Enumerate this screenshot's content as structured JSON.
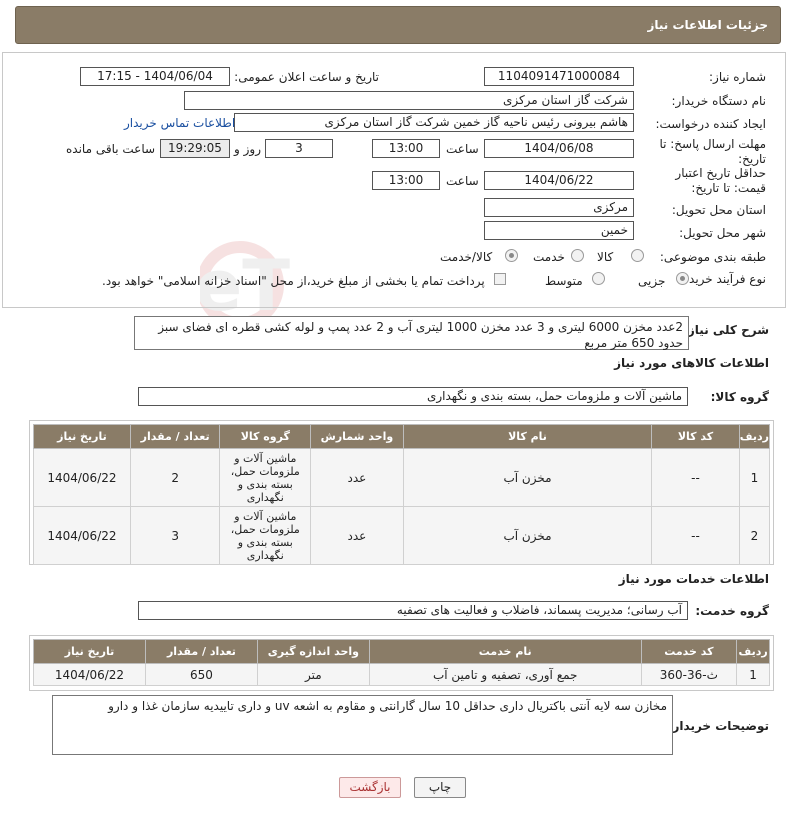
{
  "header": {
    "title": "جزئیات اطلاعات نیاز"
  },
  "form": {
    "need_number_label": "شماره نیاز:",
    "need_number": "1104091471000084",
    "announce_label": "تاریخ و ساعت اعلان عمومی:",
    "announce_value": "1404/06/04 - 17:15",
    "buyer_org_label": "نام دستگاه خریدار:",
    "buyer_org": "شرکت گاز استان مرکزی",
    "creator_label": "ایجاد کننده درخواست:",
    "creator": "هاشم بیرونی رئیس ناحیه گاز خمین شرکت گاز استان مرکزی",
    "contact_link": "اطلاعات تماس خریدار",
    "deadline_label": "مهلت ارسال پاسخ: تا تاریخ:",
    "deadline_date": "1404/06/08",
    "time_label": "ساعت",
    "deadline_time": "13:00",
    "days_value": "3",
    "days_label": "روز و",
    "remaining_time": "19:29:05",
    "remaining_label": "ساعت باقی مانده",
    "price_validity_label": "حداقل تاریخ اعتبار قیمت: تا تاریخ:",
    "price_validity_date": "1404/06/22",
    "price_validity_time": "13:00",
    "province_label": "استان محل تحویل:",
    "province": "مرکزی",
    "city_label": "شهر محل تحویل:",
    "city": "خمین",
    "category_label": "طبقه بندی موضوعی:",
    "category_options": [
      "کالا",
      "خدمت",
      "کالا/خدمت"
    ],
    "process_label": "نوع فرآیند خرید :",
    "process_options": [
      "جزیی",
      "متوسط"
    ],
    "payment_note": "پرداخت تمام یا بخشی از مبلغ خرید،از محل \"اسناد خزانه اسلامی\" خواهد بود."
  },
  "description": {
    "label": "شرح کلی نیاز:",
    "text": "2عدد مخزن 6000 لیتری و 3 عدد مخزن 1000 لیتری آب و 2 عدد پمپ و لوله کشی قطره ای فضای سبز حدود 650 متر مربع"
  },
  "goods": {
    "section_title": "اطلاعات کالاهای مورد نیاز",
    "group_label": "گروه کالا:",
    "group_value": "ماشین آلات و ملزومات حمل، بسته بندی و نگهداری",
    "headers": [
      "ردیف",
      "کد کالا",
      "نام کالا",
      "واحد شمارش",
      "گروه کالا",
      "تعداد / مقدار",
      "تاریخ نیاز"
    ],
    "rows": [
      [
        "1",
        "--",
        "مخزن آب",
        "عدد",
        "ماشین آلات و ملزومات حمل، بسته بندی و نگهداری",
        "2",
        "1404/06/22"
      ],
      [
        "2",
        "--",
        "مخزن آب",
        "عدد",
        "ماشین آلات و ملزومات حمل، بسته بندی و نگهداری",
        "3",
        "1404/06/22"
      ]
    ]
  },
  "services": {
    "section_title": "اطلاعات خدمات مورد نیاز",
    "group_label": "گروه خدمت:",
    "group_value": "آب رسانی؛ مدیریت پسماند، فاضلاب و فعالیت های تصفیه",
    "headers": [
      "ردیف",
      "کد خدمت",
      "نام خدمت",
      "واحد اندازه گیری",
      "تعداد / مقدار",
      "تاریخ نیاز"
    ],
    "rows": [
      [
        "1",
        "ث-36-360",
        "جمع آوری، تصفیه و تامین آب",
        "متر",
        "650",
        "1404/06/22"
      ]
    ]
  },
  "buyer_notes": {
    "label": "توضیحات خریدار:",
    "text": "مخازن سه لایه آنتی باکتریال داری حداقل 10 سال گارانتی و مقاوم به اشعه uv و داری تاییدیه سازمان غذا و دارو"
  },
  "buttons": {
    "print": "چاپ",
    "back": "بازگشت"
  },
  "watermark": "AriaTender.neT"
}
